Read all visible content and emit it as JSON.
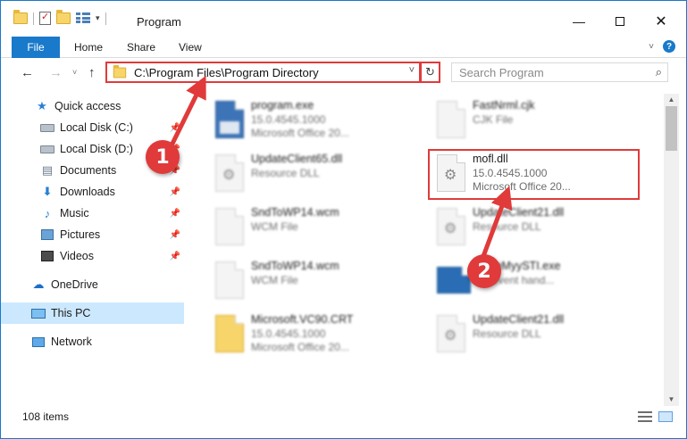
{
  "titlebar": {
    "title": "Program",
    "minimize": "—",
    "maximize": "",
    "close": "✕"
  },
  "ribbon": {
    "tabs": [
      {
        "label": "File"
      },
      {
        "label": "Home"
      },
      {
        "label": "Share"
      },
      {
        "label": "View"
      }
    ],
    "help": "?"
  },
  "navbar": {
    "back": "←",
    "forward": "→",
    "recent": "˅",
    "up": "↑",
    "address": "C:\\Program Files\\Program Directory",
    "address_dropdown": "˅",
    "refresh": "↻",
    "search_placeholder": "Search Program",
    "search_icon": "⚲"
  },
  "sidebar": {
    "items": [
      {
        "label": "Quick access"
      },
      {
        "label": "Local Disk (C:)"
      },
      {
        "label": "Local Disk (D:)"
      },
      {
        "label": "Documents"
      },
      {
        "label": "Downloads"
      },
      {
        "label": "Music"
      },
      {
        "label": "Pictures"
      },
      {
        "label": "Videos"
      },
      {
        "label": "OneDrive"
      },
      {
        "label": "This PC"
      },
      {
        "label": "Network"
      }
    ]
  },
  "files": [
    {
      "name": "program.exe",
      "line1": "15.0.4545.1000",
      "line2": "Microsoft Office 20..."
    },
    {
      "name": "FastNrml.cjk",
      "line1": "CJK File",
      "line2": ""
    },
    {
      "name": "UpdateClient65.dll",
      "line1": "Resource DLL",
      "line2": ""
    },
    {
      "name": "mofl.dll",
      "line1": "15.0.4545.1000",
      "line2": "Microsoft Office 20..."
    },
    {
      "name": "SndToWP14.wcm",
      "line1": "WCM File",
      "line2": ""
    },
    {
      "name": "UpdateClient21.dll",
      "line1": "Resource DLL",
      "line2": ""
    },
    {
      "name": "SndToWP14.wcm",
      "line1": "WCM File",
      "line2": ""
    },
    {
      "name": "OfficeMyySTI.exe",
      "line1": "STI event hand...",
      "line2": ""
    },
    {
      "name": "Microsoft.VC90.CRT",
      "line1": "15.0.4545.1000",
      "line2": "Microsoft Office 20..."
    },
    {
      "name": "UpdateClient21.dll",
      "line1": "Resource DLL",
      "line2": ""
    }
  ],
  "status": {
    "item_count": "108 items"
  },
  "annotations": {
    "step1": "1",
    "step2": "2"
  },
  "colors": {
    "accent": "#1979ca",
    "annotation": "#e03a3a",
    "selection": "#cce8ff"
  }
}
